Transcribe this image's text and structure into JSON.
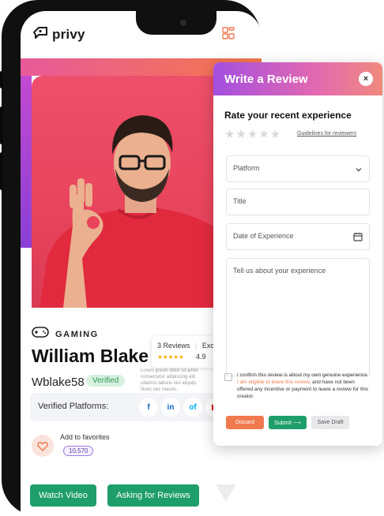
{
  "app": {
    "logo_text": "privy"
  },
  "profile": {
    "category": "GAMING",
    "name": "William Blake",
    "username": "Wblake58",
    "verified_label": "Verified",
    "reviews_count": "3 Reviews",
    "reviews_extra": "Exce",
    "rating": "4.9",
    "stars": "★★★★★",
    "faded_lines": [
      "Lorem ipsum dolor sit amet",
      "consectetur adipiscing elit.",
      "ullamco laboris nisi aliquip.",
      "Nunc nec mauris."
    ],
    "verified_platforms_label": "Verified Platforms:",
    "platforms": [
      "f",
      "in",
      "of",
      "▶"
    ],
    "add_favorites_label": "Add to favorites",
    "favorites_count": "10,570",
    "watch_video_label": "Watch Video",
    "asking_reviews_label": "Asking for Reviews"
  },
  "modal": {
    "title": "Write a Review",
    "close_icon": "×",
    "rate_heading": "Rate your recent experience",
    "stars": "★★★★★",
    "guidelines_link": "Guidelines for reviewers",
    "platform_placeholder": "Platform",
    "title_placeholder": "Title",
    "date_placeholder": "Date of Experience",
    "experience_placeholder": "Tell us about your experience",
    "consent_pre": "I confirm this review is about my own genuine experience. ",
    "consent_link": "I am eligible to leave this review,",
    "consent_post": " and have not been offered any incentive or payment to leave a review for this creator.",
    "discard_label": "Discard",
    "submit_label": "Submit ⟶",
    "save_draft_label": "Save Draft"
  },
  "colors": {
    "accent_green": "#1e9e6a",
    "discard_orange": "#f07a4e",
    "star_gold": "#f3b21b",
    "hero_pink": "#ee4f6a",
    "modal_gradient_start": "#a44fe0"
  }
}
